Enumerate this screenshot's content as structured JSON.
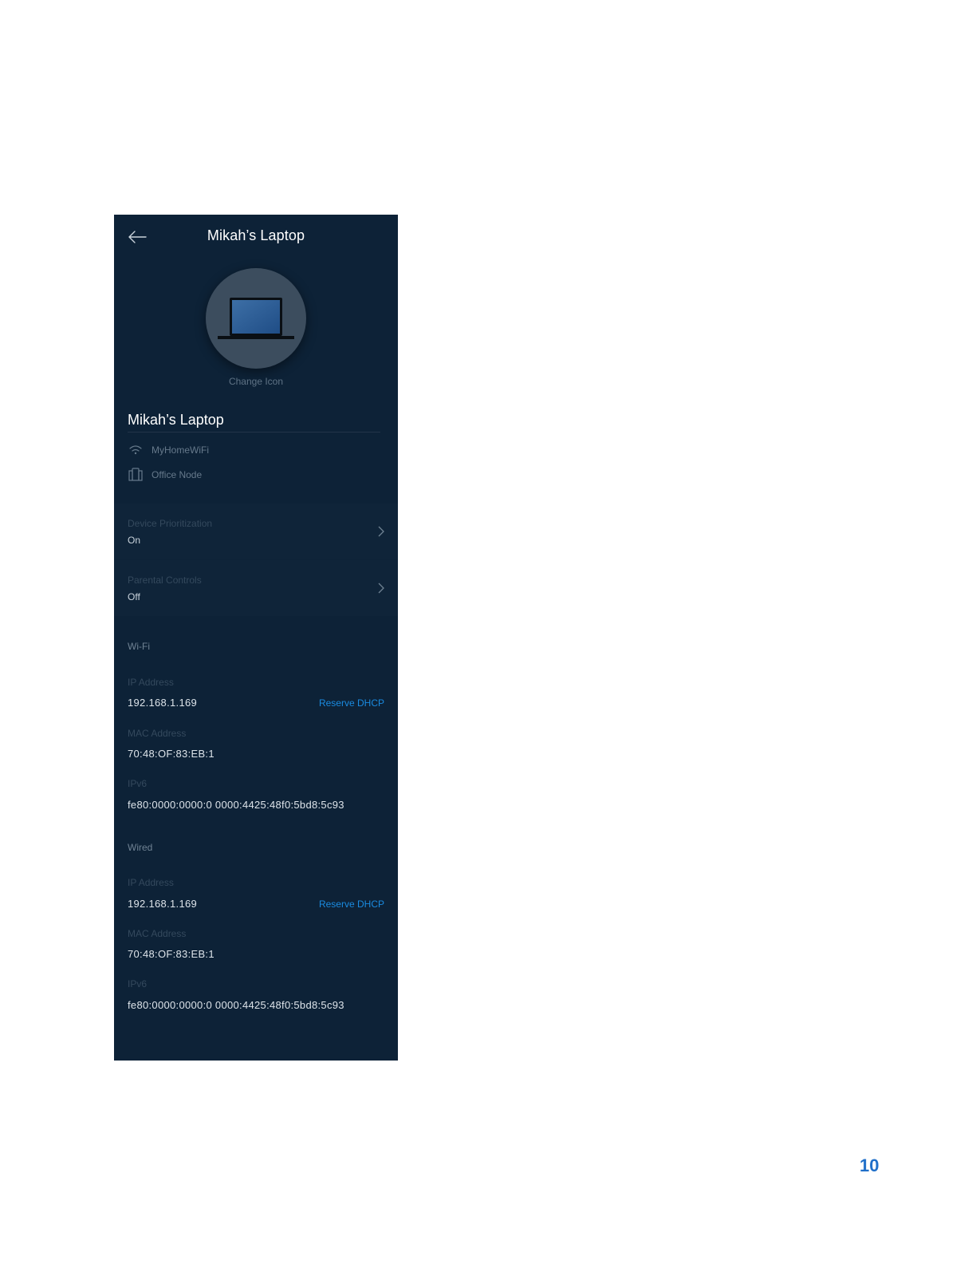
{
  "header": {
    "title": "Mikah’s Laptop"
  },
  "device": {
    "change_icon_label": "Change Icon",
    "name": "Mikah’s Laptop",
    "network_name": "MyHomeWiFi",
    "node_name": "Office Node"
  },
  "settings": [
    {
      "label": "Device Prioritization",
      "value": "On"
    },
    {
      "label": "Parental Controls",
      "value": "Off"
    }
  ],
  "wifi": {
    "header": "Wi-Fi",
    "ip_label": "IP Address",
    "ip_value": "192.168.1.169",
    "reserve_label": "Reserve DHCP",
    "mac_label": "MAC Address",
    "mac_value": "70:48:OF:83:EB:1",
    "ipv6_label": "IPv6",
    "ipv6_value": "fe80:0000:0000:0 0000:4425:48f0:5bd8:5c93"
  },
  "wired": {
    "header": "Wired",
    "ip_label": "IP Address",
    "ip_value": "192.168.1.169",
    "reserve_label": "Reserve DHCP",
    "mac_label": "MAC Address",
    "mac_value": "70:48:OF:83:EB:1",
    "ipv6_label": "IPv6",
    "ipv6_value": "fe80:0000:0000:0 0000:4425:48f0:5bd8:5c93"
  },
  "page": {
    "number": "10"
  },
  "colors": {
    "panel_bg": "#0d2237",
    "link": "#1a8be0",
    "page_number": "#1f6fc9"
  },
  "icons": [
    "back-arrow-icon",
    "laptop-icon",
    "wifi-icon",
    "node-icon",
    "chevron-right-icon"
  ]
}
